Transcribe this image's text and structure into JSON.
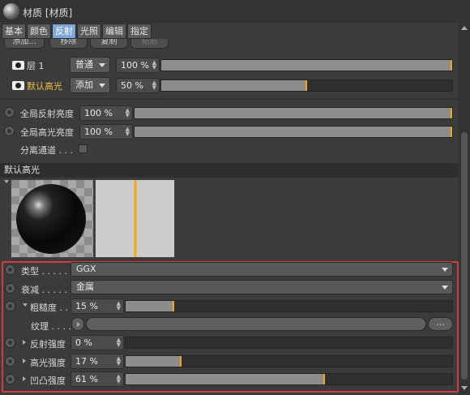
{
  "window": {
    "title": "材质 [材质]"
  },
  "tabs": [
    "基本",
    "颜色",
    "反射",
    "光照",
    "编辑",
    "指定"
  ],
  "active_tab": "反射",
  "layer_buttons": {
    "add": "添加...",
    "remove": "移除",
    "copy": "复制",
    "paste": "粘贴"
  },
  "layers": [
    {
      "name": "层 1",
      "mode": "普通",
      "value": "100 %",
      "fill": 1.0
    },
    {
      "name": "默认高光",
      "mode": "添加",
      "value": "50 %",
      "fill": 0.5
    }
  ],
  "global": {
    "reflection_label": "全局反射亮度",
    "reflection_value": "100 %",
    "reflection_fill": 1.0,
    "specular_label": "全局高光亮度",
    "specular_value": "100 %",
    "specular_fill": 1.0,
    "separate_pass_label": "分离通道 . . ."
  },
  "section": {
    "title": "默认高光"
  },
  "properties": {
    "type_label": "类型 . . . . . . .",
    "type_value": "GGX",
    "attenuation_label": "衰减 . . . . . . .",
    "attenuation_value": "金属",
    "roughness_label": "粗糙度 . .",
    "roughness_value": "15 %",
    "roughness_fill": 0.15,
    "texture_label": "纹理 . . . .",
    "texture_more": "...",
    "reflection_strength_label": "反射强度",
    "reflection_strength_value": "0 %",
    "reflection_strength_fill": 0.0,
    "specular_strength_label": "高光强度",
    "specular_strength_value": "17 %",
    "specular_strength_fill": 0.17,
    "bump_strength_label": "凹凸强度",
    "bump_strength_value": "61 %",
    "bump_strength_fill": 0.61
  },
  "colors": {
    "accent": "#f0a81c",
    "highlight_box": "#d23b3b",
    "active_tab": "#7aa7d6"
  }
}
